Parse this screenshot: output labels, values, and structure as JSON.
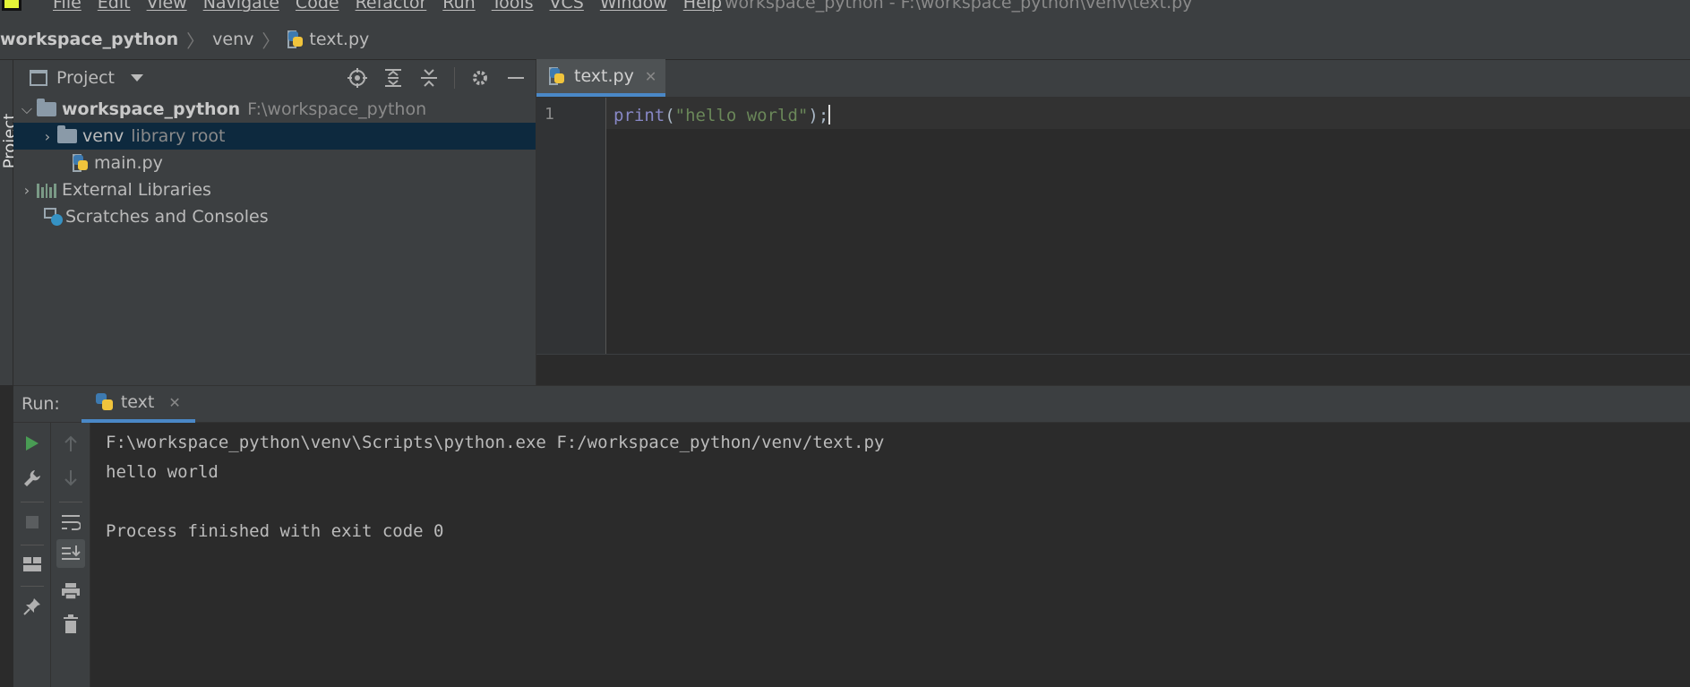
{
  "menu": {
    "items": [
      "File",
      "Edit",
      "View",
      "Navigate",
      "Code",
      "Refactor",
      "Run",
      "Tools",
      "VCS",
      "Window",
      "Help"
    ],
    "window_title": "workspace_python - F:\\workspace_python\\venv\\text.py"
  },
  "breadcrumb": {
    "project": "workspace_python",
    "folder": "venv",
    "file": "text.py"
  },
  "left_strip": {
    "label": "Project"
  },
  "project_panel": {
    "title": "Project",
    "tree": {
      "root_name": "workspace_python",
      "root_path": "F:\\workspace_python",
      "venv_name": "venv",
      "venv_note": "library root",
      "main_file": "main.py",
      "external_libraries": "External Libraries",
      "scratches": "Scratches and Consoles"
    }
  },
  "editor": {
    "tab_label": "text.py",
    "line_number": "1",
    "code": {
      "func": "print",
      "open": "(",
      "string": "\"hello world\"",
      "close": ");"
    }
  },
  "run_panel": {
    "label": "Run:",
    "tab_label": "text",
    "console": [
      "F:\\workspace_python\\venv\\Scripts\\python.exe F:/workspace_python/venv/text.py",
      "hello world",
      "",
      "Process finished with exit code 0"
    ]
  },
  "colors": {
    "accent": "#4a88c7",
    "run_green": "#499c54",
    "selection": "#0d293e",
    "string_green": "#6a8759",
    "builtin_purple": "#8888c6"
  },
  "icons": [
    "locate-icon",
    "expand-all-icon",
    "collapse-all-icon",
    "gear-icon",
    "minimize-icon",
    "run-icon",
    "wrench-icon",
    "stop-icon",
    "layout-icon",
    "pin-icon",
    "up-arrow-icon",
    "down-arrow-icon",
    "soft-wrap-icon",
    "scroll-to-end-icon",
    "print-icon",
    "trash-icon"
  ]
}
